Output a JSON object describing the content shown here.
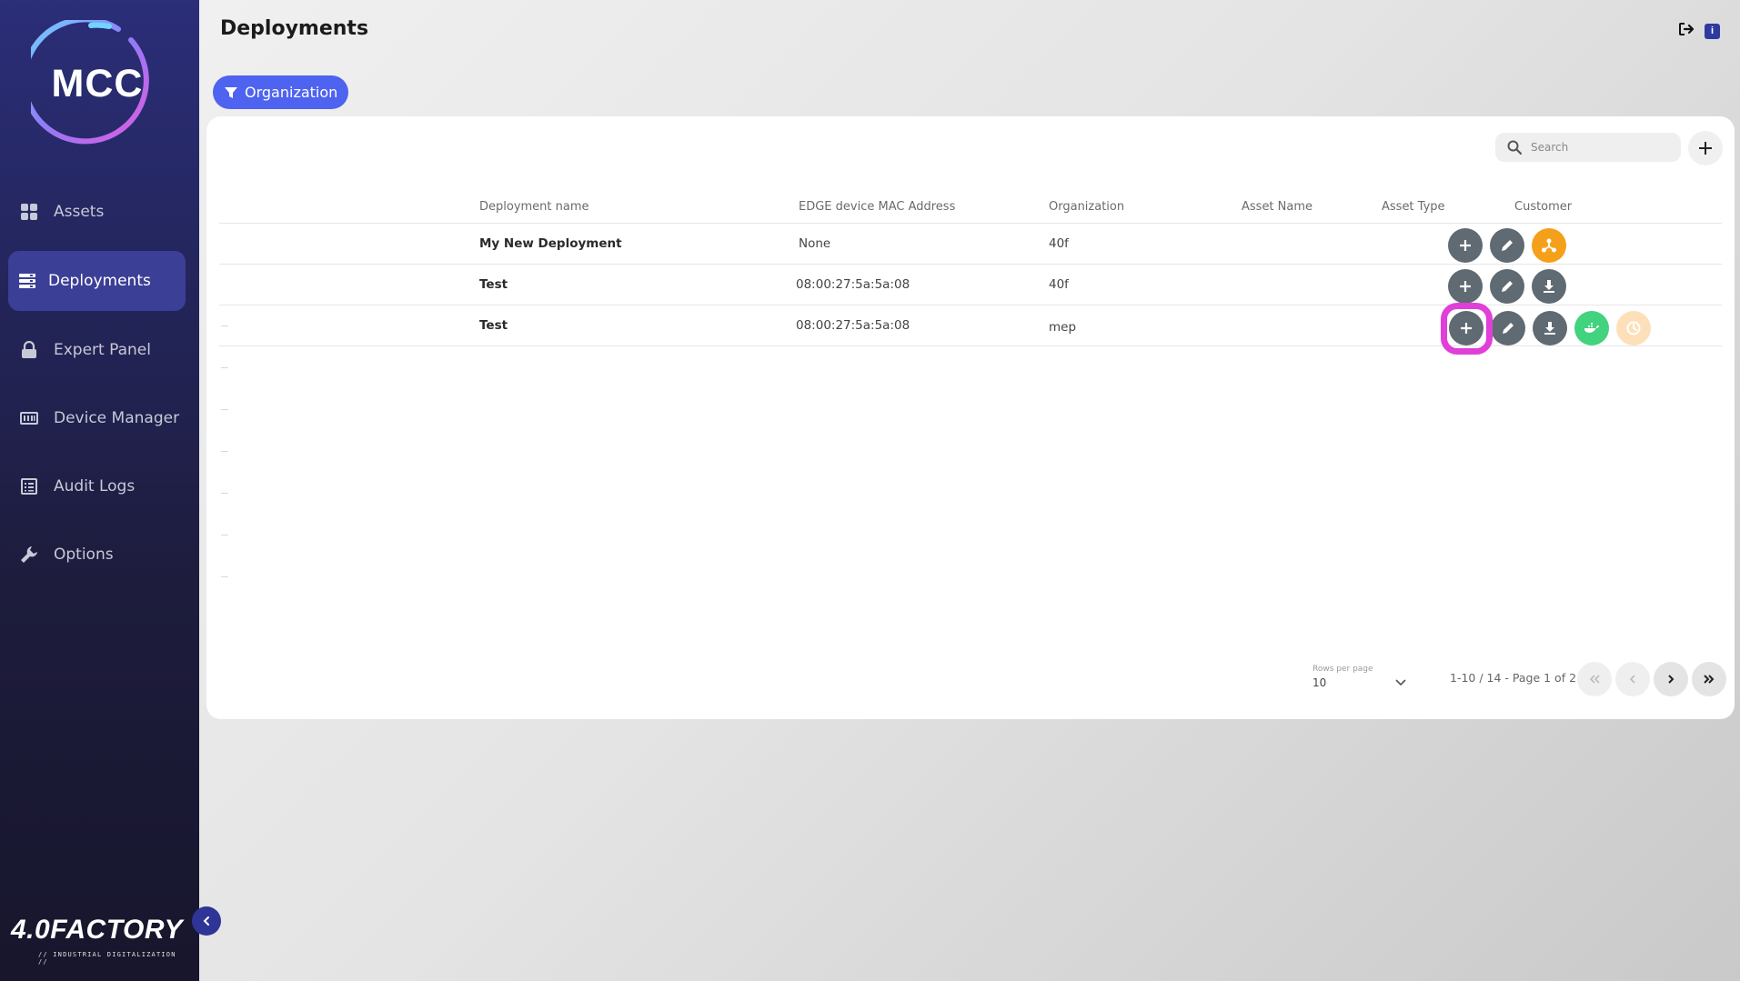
{
  "app": {
    "logo_text": "MCC",
    "brand_name": "4.0FACTORY",
    "brand_tagline": "// INDUSTRIAL DIGITALIZATION //"
  },
  "sidebar": {
    "items": [
      {
        "label": "Assets",
        "icon": "grid-icon"
      },
      {
        "label": "Deployments",
        "icon": "server-list-icon",
        "active": true
      },
      {
        "label": "Expert Panel",
        "icon": "lock-icon"
      },
      {
        "label": "Device Manager",
        "icon": "device-icon"
      },
      {
        "label": "Audit Logs",
        "icon": "list-icon"
      },
      {
        "label": "Options",
        "icon": "wrench-icon"
      }
    ]
  },
  "header": {
    "title": "Deployments",
    "info_badge": "i"
  },
  "filter": {
    "label": "Organization"
  },
  "search": {
    "placeholder": "Search"
  },
  "table": {
    "columns": [
      "Deployment name",
      "EDGE device MAC Address",
      "Organization",
      "Asset Name",
      "Asset Type",
      "Customer"
    ],
    "rows": [
      {
        "name": "My New Deployment",
        "mac": "None",
        "org": "40f",
        "asset_name": "",
        "asset_type": "",
        "customer": ""
      },
      {
        "name": "Test",
        "mac": "08:00:27:5a:5a:08",
        "org": "40f",
        "asset_name": "",
        "asset_type": "",
        "customer": ""
      },
      {
        "name": "Test",
        "mac": "08:00:27:5a:5a:08",
        "org": "mep",
        "asset_name": "",
        "asset_type": "",
        "customer": ""
      }
    ]
  },
  "pagination": {
    "rows_per_page_label": "Rows per page",
    "rows_per_page": "10",
    "info": "1-10 / 14 - Page 1 of 2"
  },
  "colors": {
    "accent": "#4e63ef",
    "sidebar_active": "#3b3f96",
    "action_gray": "#5f6a72",
    "action_orange": "#f5a01a",
    "action_green": "#41d37e",
    "action_peach": "#fde0b9",
    "highlight": "#e03fd8"
  }
}
